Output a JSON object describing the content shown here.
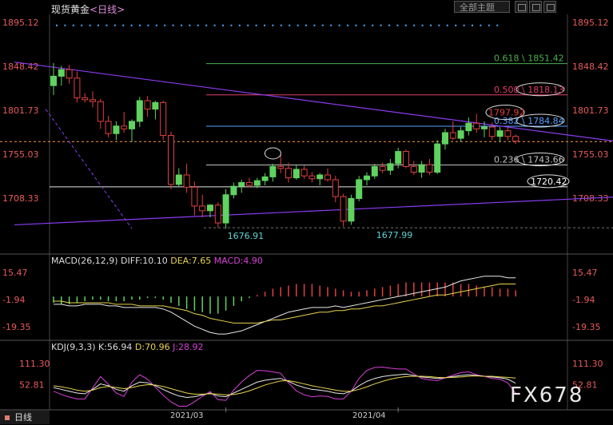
{
  "header": {
    "instrument": "现货黄金",
    "period_label": "<日线>",
    "dropdown_label": "全部主题",
    "button_icons": [
      "layout-icon",
      "settings-icon",
      "close-icon"
    ]
  },
  "colors": {
    "up": "#5fd35f",
    "down": "#e04040",
    "axis_price": "#e85a5a",
    "trendline": "#8a3cf0",
    "fib_618": "#4caf50",
    "fib_500": "#e0406a",
    "fib_382": "#5aa0ff",
    "fib_236": "#c0c0c0"
  },
  "chart_data": [
    {
      "type": "candlestick",
      "title": "现货黄金 <日线>",
      "y_ticks": [
        "1895.12",
        "1848.42",
        "1801.73",
        "1755.03",
        "1708.33"
      ],
      "ylim": [
        1660,
        1902
      ],
      "x_labels": [
        {
          "label": "2021/03",
          "index": 22
        },
        {
          "label": "2021/04",
          "index": 44
        }
      ],
      "candles": [
        {
          "o": 1828,
          "h": 1852,
          "l": 1818,
          "c": 1838
        },
        {
          "o": 1838,
          "h": 1849,
          "l": 1828,
          "c": 1845
        },
        {
          "o": 1845,
          "h": 1850,
          "l": 1830,
          "c": 1836
        },
        {
          "o": 1836,
          "h": 1843,
          "l": 1810,
          "c": 1815
        },
        {
          "o": 1815,
          "h": 1820,
          "l": 1810,
          "c": 1813
        },
        {
          "o": 1813,
          "h": 1822,
          "l": 1805,
          "c": 1811
        },
        {
          "o": 1811,
          "h": 1814,
          "l": 1782,
          "c": 1790
        },
        {
          "o": 1790,
          "h": 1796,
          "l": 1773,
          "c": 1777
        },
        {
          "o": 1777,
          "h": 1790,
          "l": 1770,
          "c": 1785
        },
        {
          "o": 1785,
          "h": 1800,
          "l": 1778,
          "c": 1782
        },
        {
          "o": 1782,
          "h": 1792,
          "l": 1768,
          "c": 1790
        },
        {
          "o": 1790,
          "h": 1816,
          "l": 1784,
          "c": 1812
        },
        {
          "o": 1812,
          "h": 1817,
          "l": 1795,
          "c": 1803
        },
        {
          "o": 1803,
          "h": 1812,
          "l": 1792,
          "c": 1810
        },
        {
          "o": 1810,
          "h": 1812,
          "l": 1770,
          "c": 1775
        },
        {
          "o": 1775,
          "h": 1779,
          "l": 1718,
          "c": 1723
        },
        {
          "o": 1723,
          "h": 1740,
          "l": 1720,
          "c": 1733
        },
        {
          "o": 1733,
          "h": 1745,
          "l": 1714,
          "c": 1720
        },
        {
          "o": 1720,
          "h": 1726,
          "l": 1690,
          "c": 1700
        },
        {
          "o": 1700,
          "h": 1712,
          "l": 1688,
          "c": 1695
        },
        {
          "o": 1695,
          "h": 1702,
          "l": 1688,
          "c": 1701
        },
        {
          "o": 1701,
          "h": 1704,
          "l": 1677,
          "c": 1682
        },
        {
          "o": 1682,
          "h": 1718,
          "l": 1676,
          "c": 1712
        },
        {
          "o": 1712,
          "h": 1725,
          "l": 1708,
          "c": 1721
        },
        {
          "o": 1721,
          "h": 1728,
          "l": 1714,
          "c": 1725
        },
        {
          "o": 1725,
          "h": 1730,
          "l": 1720,
          "c": 1722
        },
        {
          "o": 1722,
          "h": 1730,
          "l": 1719,
          "c": 1727
        },
        {
          "o": 1727,
          "h": 1735,
          "l": 1722,
          "c": 1731
        },
        {
          "o": 1731,
          "h": 1745,
          "l": 1726,
          "c": 1742
        },
        {
          "o": 1742,
          "h": 1755,
          "l": 1735,
          "c": 1740
        },
        {
          "o": 1740,
          "h": 1746,
          "l": 1725,
          "c": 1730
        },
        {
          "o": 1730,
          "h": 1744,
          "l": 1728,
          "c": 1739
        },
        {
          "o": 1739,
          "h": 1743,
          "l": 1729,
          "c": 1732
        },
        {
          "o": 1732,
          "h": 1736,
          "l": 1725,
          "c": 1729
        },
        {
          "o": 1729,
          "h": 1735,
          "l": 1722,
          "c": 1733
        },
        {
          "o": 1733,
          "h": 1740,
          "l": 1726,
          "c": 1728
        },
        {
          "o": 1728,
          "h": 1732,
          "l": 1704,
          "c": 1710
        },
        {
          "o": 1710,
          "h": 1713,
          "l": 1678,
          "c": 1684
        },
        {
          "o": 1684,
          "h": 1712,
          "l": 1680,
          "c": 1708
        },
        {
          "o": 1708,
          "h": 1732,
          "l": 1705,
          "c": 1728
        },
        {
          "o": 1728,
          "h": 1736,
          "l": 1722,
          "c": 1732
        },
        {
          "o": 1732,
          "h": 1745,
          "l": 1729,
          "c": 1742
        },
        {
          "o": 1742,
          "h": 1746,
          "l": 1735,
          "c": 1738
        },
        {
          "o": 1738,
          "h": 1750,
          "l": 1733,
          "c": 1745
        },
        {
          "o": 1745,
          "h": 1762,
          "l": 1740,
          "c": 1758
        },
        {
          "o": 1758,
          "h": 1760,
          "l": 1740,
          "c": 1742
        },
        {
          "o": 1742,
          "h": 1748,
          "l": 1733,
          "c": 1736
        },
        {
          "o": 1736,
          "h": 1748,
          "l": 1730,
          "c": 1744
        },
        {
          "o": 1744,
          "h": 1750,
          "l": 1733,
          "c": 1736
        },
        {
          "o": 1736,
          "h": 1770,
          "l": 1734,
          "c": 1766
        },
        {
          "o": 1766,
          "h": 1782,
          "l": 1760,
          "c": 1778
        },
        {
          "o": 1778,
          "h": 1790,
          "l": 1770,
          "c": 1772
        },
        {
          "o": 1772,
          "h": 1784,
          "l": 1768,
          "c": 1780
        },
        {
          "o": 1780,
          "h": 1794,
          "l": 1775,
          "c": 1788
        },
        {
          "o": 1788,
          "h": 1798,
          "l": 1778,
          "c": 1782
        },
        {
          "o": 1782,
          "h": 1790,
          "l": 1773,
          "c": 1784
        },
        {
          "o": 1784,
          "h": 1789,
          "l": 1770,
          "c": 1774
        },
        {
          "o": 1774,
          "h": 1784,
          "l": 1768,
          "c": 1780
        },
        {
          "o": 1780,
          "h": 1784,
          "l": 1770,
          "c": 1774
        },
        {
          "o": 1774,
          "h": 1776,
          "l": 1766,
          "c": 1769
        }
      ],
      "fib_levels": [
        {
          "ratio": "0.618",
          "value": "1851.42",
          "price": 1851.42,
          "color": "#4caf50",
          "circled": false
        },
        {
          "ratio": "0.500",
          "value": "1818.13",
          "price": 1818.13,
          "color": "#e0406a",
          "circled": true
        },
        {
          "ratio": "0.382",
          "value": "1784.84",
          "price": 1784.84,
          "color": "#5aa0ff",
          "circled": true
        },
        {
          "ratio": "0.236",
          "value": "1743.66",
          "price": 1743.66,
          "color": "#c0c0c0",
          "circled": true
        }
      ],
      "horizontal_lines": [
        {
          "price": 1720.42,
          "label": "1720.42",
          "style": "solid"
        },
        {
          "price": 1768.5,
          "label": "",
          "style": "dashed"
        },
        {
          "price": 1676.91,
          "label": "",
          "style": "dashed"
        }
      ],
      "annotations": [
        {
          "label": "1797.92",
          "price": 1797.92,
          "index": 55,
          "circled": true
        },
        {
          "label": "1676.91",
          "price": 1676.91,
          "index": 22,
          "circled": false
        },
        {
          "label": "1677.99",
          "price": 1677.99,
          "index": 41,
          "circled": false
        }
      ],
      "trendlines": [
        {
          "from": [
            -5,
            1853
          ],
          "to": [
            78,
            1762
          ]
        },
        {
          "from": [
            -5,
            1680
          ],
          "to": [
            78,
            1712
          ]
        }
      ],
      "dotted_row_price": 1892
    },
    {
      "type": "bar+line",
      "title": "MACD(26,12,9)",
      "legend": [
        {
          "label": "MACD(26,12,9)",
          "color": "#dddddd"
        },
        {
          "label": "DIFF:10.10",
          "color": "#dddddd"
        },
        {
          "label": "DEA:7.65",
          "color": "#e8d44a"
        },
        {
          "label": "MACD:4.90",
          "color": "#d840d8"
        }
      ],
      "y_ticks": [
        "15.47",
        "-1.94",
        "-19.35"
      ],
      "ylim": [
        -26,
        19
      ],
      "histogram": [
        -4,
        -5,
        -5,
        -4,
        -3,
        -2,
        -2,
        -3,
        -3,
        -3,
        -2,
        -2,
        -1,
        -1,
        -2,
        -4,
        -6,
        -8,
        -9,
        -10,
        -11,
        -11,
        -9,
        -6,
        -3,
        -1,
        1,
        3,
        5,
        6,
        7,
        8,
        8,
        8,
        7,
        6,
        5,
        4,
        3,
        3,
        4,
        5,
        6,
        7,
        8,
        9,
        9,
        9,
        9,
        9,
        9,
        9,
        8,
        8,
        7,
        6,
        6,
        5,
        5,
        4
      ],
      "diff": [
        -5,
        -5,
        -6,
        -6,
        -5,
        -5,
        -5,
        -6,
        -6,
        -7,
        -7,
        -7,
        -7,
        -7,
        -8,
        -10,
        -13,
        -16,
        -19,
        -21,
        -23,
        -24,
        -24,
        -23,
        -22,
        -20,
        -18,
        -16,
        -14,
        -12,
        -10,
        -9,
        -8,
        -7,
        -7,
        -7,
        -6,
        -7,
        -6,
        -5,
        -4,
        -3,
        -2,
        -1,
        0,
        1,
        2,
        3,
        4,
        5,
        6,
        8,
        10,
        11,
        12,
        13,
        13,
        13,
        12,
        12
      ],
      "dea": [
        -3,
        -3,
        -4,
        -4,
        -4,
        -4,
        -4,
        -4,
        -5,
        -5,
        -5,
        -6,
        -6,
        -6,
        -6,
        -7,
        -8,
        -9,
        -11,
        -12,
        -14,
        -15,
        -16,
        -17,
        -17,
        -17,
        -17,
        -16,
        -15,
        -15,
        -14,
        -13,
        -12,
        -11,
        -10,
        -10,
        -9,
        -9,
        -8,
        -8,
        -7,
        -6,
        -6,
        -5,
        -4,
        -3,
        -2,
        -1,
        0,
        1,
        1,
        2,
        3,
        4,
        5,
        6,
        7,
        8,
        8,
        8
      ]
    },
    {
      "type": "line",
      "title": "KDJ(9,3,3)",
      "legend": [
        {
          "label": "KDJ(9,3,3)",
          "color": "#dddddd"
        },
        {
          "label": "K:56.94",
          "color": "#dddddd"
        },
        {
          "label": "D:70.96",
          "color": "#e8d44a"
        },
        {
          "label": "J:28.92",
          "color": "#d840d8"
        }
      ],
      "y_ticks": [
        "111.30",
        "52.81"
      ],
      "ylim": [
        -5,
        135
      ],
      "K": [
        45,
        40,
        35,
        30,
        28,
        40,
        55,
        50,
        40,
        35,
        50,
        60,
        58,
        50,
        40,
        30,
        22,
        18,
        20,
        25,
        30,
        22,
        20,
        30,
        40,
        50,
        60,
        65,
        68,
        70,
        62,
        52,
        45,
        40,
        38,
        35,
        30,
        28,
        35,
        50,
        62,
        70,
        75,
        78,
        80,
        82,
        78,
        74,
        72,
        70,
        72,
        75,
        78,
        80,
        78,
        76,
        74,
        72,
        68,
        57
      ],
      "D": [
        50,
        47,
        43,
        38,
        35,
        38,
        45,
        48,
        45,
        42,
        45,
        50,
        53,
        52,
        48,
        42,
        36,
        30,
        27,
        27,
        28,
        27,
        25,
        26,
        30,
        36,
        44,
        52,
        58,
        63,
        64,
        60,
        55,
        50,
        46,
        42,
        38,
        35,
        35,
        40,
        47,
        55,
        62,
        68,
        72,
        75,
        76,
        76,
        75,
        73,
        72,
        73,
        74,
        76,
        77,
        76,
        76,
        74,
        73,
        71
      ],
      "J": [
        35,
        26,
        19,
        14,
        14,
        44,
        75,
        54,
        30,
        21,
        60,
        80,
        68,
        46,
        24,
        6,
        -6,
        -6,
        6,
        21,
        34,
        12,
        10,
        38,
        60,
        78,
        92,
        91,
        88,
        84,
        58,
        36,
        25,
        20,
        22,
        21,
        14,
        14,
        35,
        70,
        92,
        100,
        101,
        98,
        96,
        96,
        82,
        70,
        66,
        64,
        72,
        79,
        86,
        88,
        80,
        76,
        70,
        68,
        58,
        29
      ]
    }
  ],
  "watermark": "FX678",
  "period_tab": "日线"
}
